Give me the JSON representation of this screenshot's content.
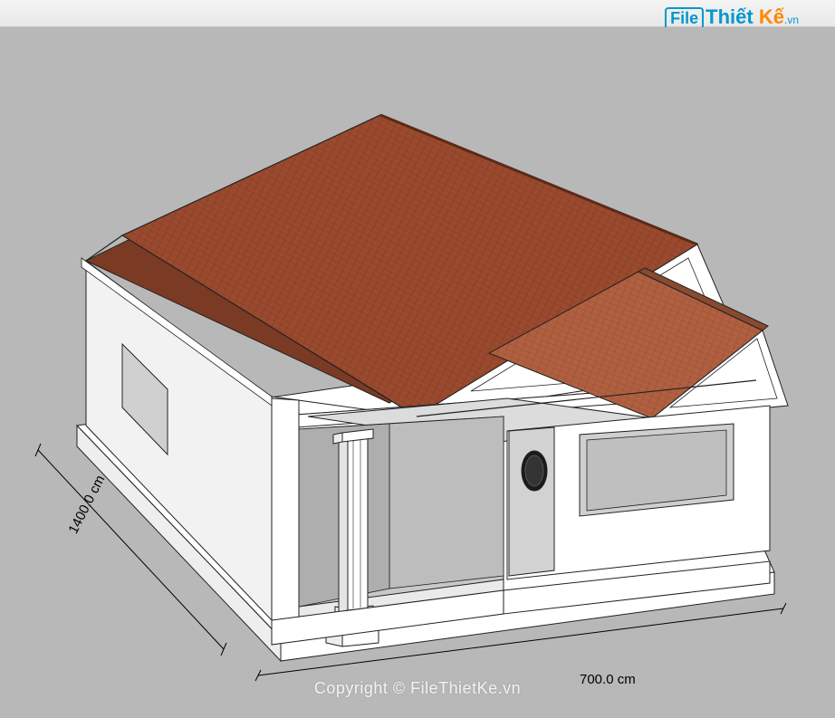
{
  "logo": {
    "part1": "File",
    "part2": "Thiết",
    "part3": "Kế",
    "part4": ".vn"
  },
  "model": {
    "dimensions": {
      "depth_label": "1400.0 cm",
      "width_label": "700.0 cm",
      "depth_cm": 1400.0,
      "width_cm": 700.0
    },
    "description": "Single-story house 3D model with gable tile roof, front porch with column, side window opening"
  },
  "render": {
    "roof_fill": "#9a4a2e",
    "roof_fill_shade": "#b86a3f",
    "wall_fill": "#ffffff",
    "wall_shade": "#ececec",
    "wall_shade2": "#d8d8d8",
    "line": "#222222",
    "ground": "#b8b8b8"
  },
  "copyright": "Copyright © FileThietKe.vn"
}
